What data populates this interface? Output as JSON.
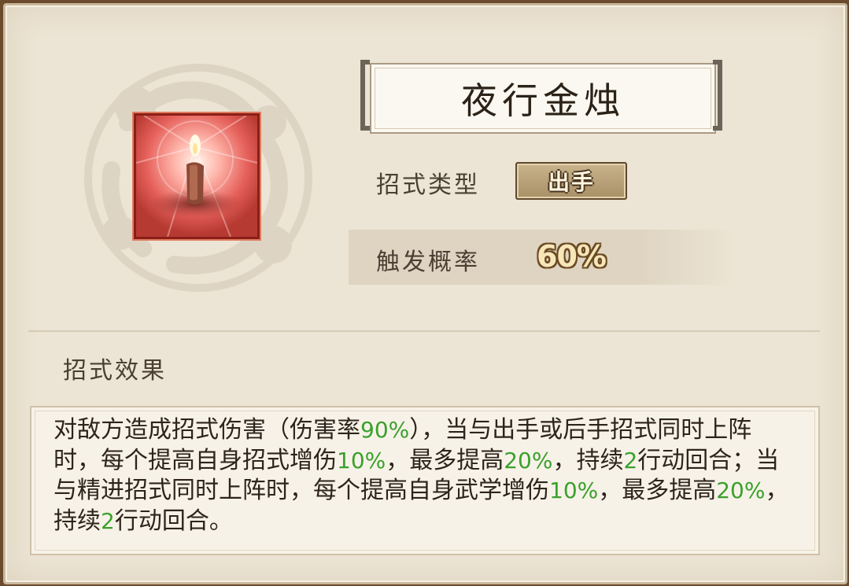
{
  "skill": {
    "name": "夜行金烛",
    "type_label": "招式类型",
    "type_value": "出手",
    "prob_label": "触发概率",
    "prob_value": "60%",
    "effect_label": "招式效果",
    "effect_segments": [
      {
        "text": "对敌方造成招式伤害（伤害率",
        "highlight": false
      },
      {
        "text": "90%",
        "highlight": true
      },
      {
        "text": "），当与出手或后手招式同时上阵时，每个提高自身招式增伤",
        "highlight": false
      },
      {
        "text": "10%",
        "highlight": true
      },
      {
        "text": "，最多提高",
        "highlight": false
      },
      {
        "text": "20%",
        "highlight": true
      },
      {
        "text": "，持续",
        "highlight": false
      },
      {
        "text": "2",
        "highlight": true
      },
      {
        "text": "行动回合；当与精进招式同时上阵时，每个提高自身武学增伤",
        "highlight": false
      },
      {
        "text": "10%",
        "highlight": true
      },
      {
        "text": "，最多提高",
        "highlight": false
      },
      {
        "text": "20%",
        "highlight": true
      },
      {
        "text": "，持续",
        "highlight": false
      },
      {
        "text": "2",
        "highlight": true
      },
      {
        "text": "行动回合。",
        "highlight": false
      }
    ],
    "icon": "candle-icon"
  },
  "colors": {
    "highlight": "#3aa12c",
    "icon_frame": "#c0392b",
    "panel_bg": "#ece4d4"
  }
}
